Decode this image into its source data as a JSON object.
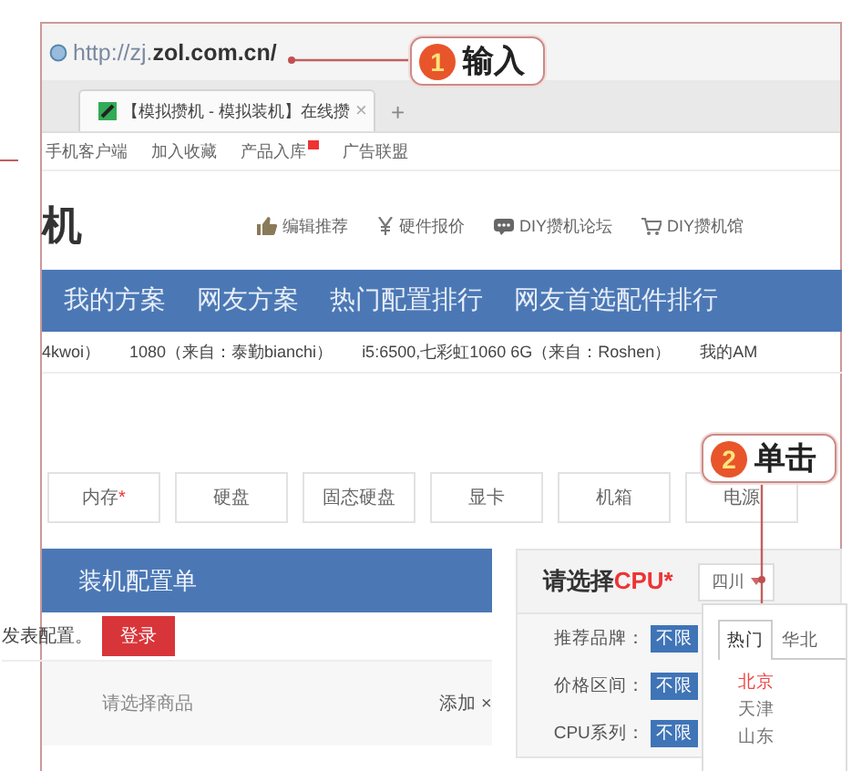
{
  "browser": {
    "url_prefix": "http://zj.",
    "url_domain": "zol.com.cn/",
    "tab_title": "【模拟攒机 - 模拟装机】在线攒",
    "tab_close": "×",
    "new_tab": "+"
  },
  "link_bar": [
    {
      "label": "手机客户端",
      "new_badge": false
    },
    {
      "label": "加入收藏",
      "new_badge": false
    },
    {
      "label": "产品入库",
      "new_badge": true
    },
    {
      "label": "广告联盟",
      "new_badge": false
    }
  ],
  "site": {
    "logo_fragment": "机",
    "top_links": [
      {
        "label": "编辑推荐"
      },
      {
        "label": "硬件报价"
      },
      {
        "label": "DIY攒机论坛"
      },
      {
        "label": "DIY攒机馆"
      }
    ]
  },
  "nav": [
    "我的方案",
    "网友方案",
    "热门配置排行",
    "网友首选配件排行"
  ],
  "ticker": [
    "4kwoi）",
    "1080（来自：泰勤bianchi）",
    "i5:6500,七彩虹1060 6G（来自：Roshen）",
    "我的AM"
  ],
  "parts": [
    {
      "label": "内存",
      "mark": "*"
    },
    {
      "label": "硬盘"
    },
    {
      "label": "固态硬盘"
    },
    {
      "label": "显卡"
    },
    {
      "label": "机箱"
    },
    {
      "label": "电源"
    }
  ],
  "config_list": {
    "title": "装机配置单",
    "login_note": "发表配置。",
    "login_button": "登录",
    "item_placeholder": "请选择商品",
    "add_link": "添加",
    "remove": "×"
  },
  "cpu_panel": {
    "title": "请选择",
    "title_highlight": "CPU*",
    "region": "四川",
    "filters": [
      {
        "label": "推荐品牌：",
        "value": "不限"
      },
      {
        "label": "价格区间：",
        "value": "不限"
      },
      {
        "label": "CPU系列：",
        "value": "不限"
      }
    ]
  },
  "region_dropdown": {
    "tabs": [
      {
        "label": "热门",
        "selected": true
      },
      {
        "label": "华北",
        "selected": false
      }
    ],
    "cities": [
      {
        "label": "北京",
        "hovered": true
      },
      {
        "label": "天津",
        "hovered": false
      },
      {
        "label": "山东",
        "hovered": false
      }
    ]
  },
  "callouts": [
    {
      "number": "1",
      "text": "输入"
    },
    {
      "number": "2",
      "text": "单击"
    }
  ]
}
